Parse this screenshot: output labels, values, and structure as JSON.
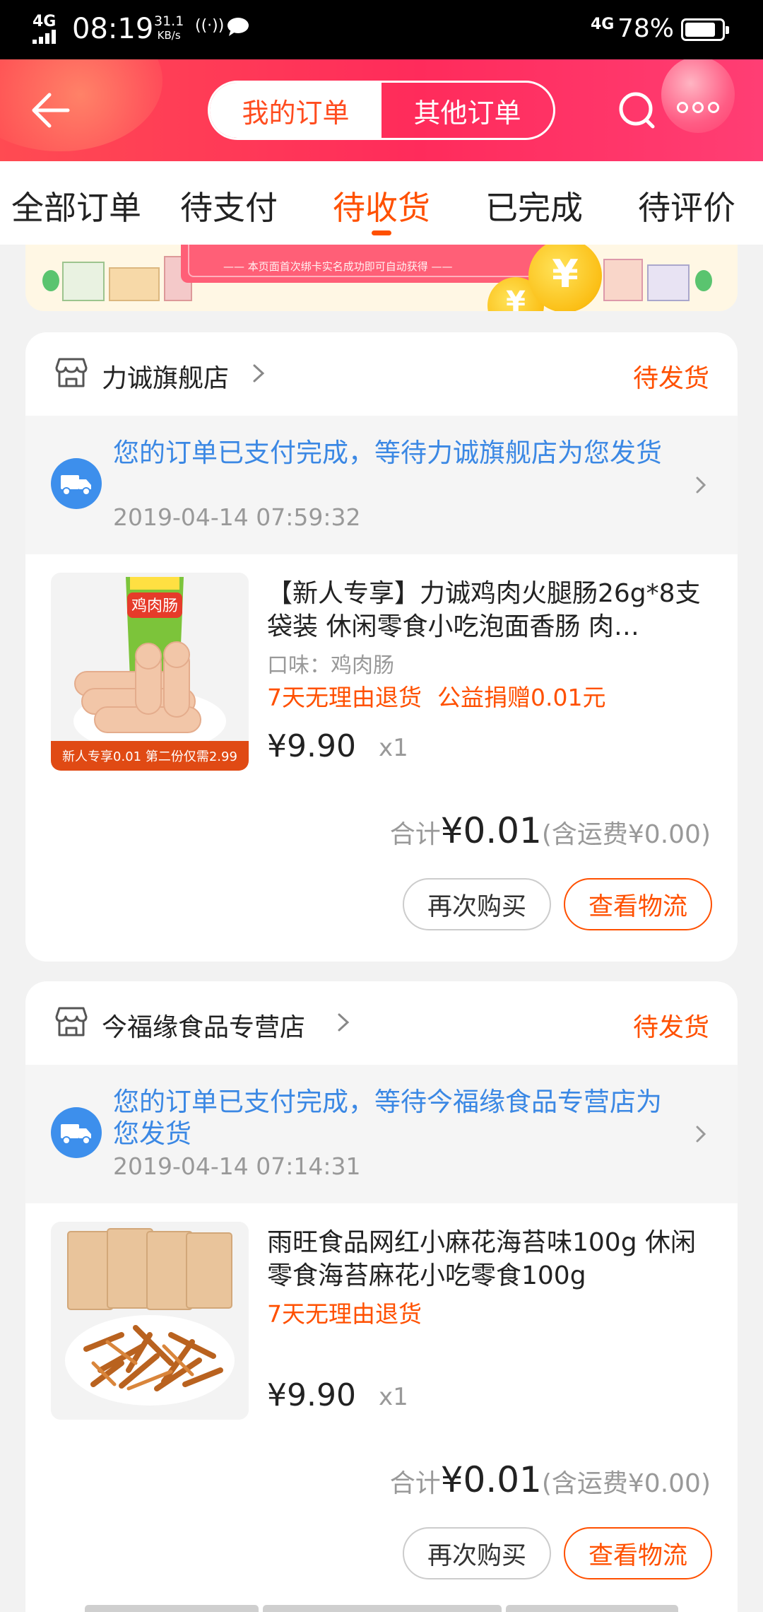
{
  "status_bar": {
    "network_left": "4G",
    "time": "08:19",
    "speed_value": "31.1",
    "speed_unit": "KB/s",
    "network_right": "4G",
    "battery": "78%"
  },
  "header": {
    "segments": [
      {
        "label": "我的订单",
        "active": true
      },
      {
        "label": "其他订单",
        "active": false
      }
    ]
  },
  "tabs": [
    {
      "label": "全部订单",
      "active": false
    },
    {
      "label": "待支付",
      "active": false
    },
    {
      "label": "待收货",
      "active": true
    },
    {
      "label": "已完成",
      "active": false
    },
    {
      "label": "待评价",
      "active": false
    }
  ],
  "banner": {
    "text": "—— 本页面首次绑卡实名成功即可自动获得 ——"
  },
  "orders": [
    {
      "shop": "力诚旗舰店",
      "status": "待发货",
      "notice": "您的订单已支付完成，等待力诚旗舰店为您发货",
      "time": "2019-04-14 07:59:32",
      "product": {
        "title": "【新人专享】力诚鸡肉火腿肠26g*8支袋装 休闲零食小吃泡面香肠 肉…",
        "spec": "口味：鸡肉肠",
        "tags": [
          "7天无理由退货",
          "公益捐赠0.01元"
        ],
        "price": "¥9.90",
        "qty": "x1",
        "image_label": "鸡肉肠",
        "image_caption": "新人专享0.01 第二份仅需2.99"
      },
      "total_label": "合计",
      "total_amount": "¥0.01",
      "shipping": "(含运费¥0.00)",
      "buttons": {
        "rebuy": "再次购买",
        "logistics": "查看物流"
      }
    },
    {
      "shop": "今福缘食品专营店",
      "status": "待发货",
      "notice": "您的订单已支付完成，等待今福缘食品专营店为您发货",
      "time": "2019-04-14 07:14:31",
      "product": {
        "title": "雨旺食品网红小麻花海苔味100g 休闲零食海苔麻花小吃零食100g",
        "tags": [
          "7天无理由退货"
        ],
        "price": "¥9.90",
        "qty": "x1"
      },
      "total_label": "合计",
      "total_amount": "¥0.01",
      "shipping": "(含运费¥0.00)",
      "buttons": {
        "rebuy": "再次购买",
        "logistics": "查看物流"
      }
    }
  ],
  "colors": {
    "accent": "#ff5000",
    "header_gradient_start": "#ff4b52",
    "header_gradient_end": "#ff3e74",
    "notice_blue": "#3b88e4"
  }
}
